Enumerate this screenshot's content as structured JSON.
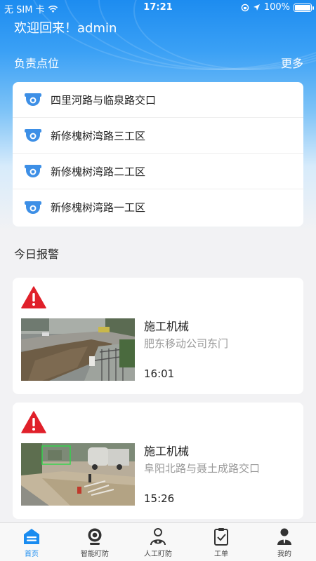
{
  "status_bar": {
    "carrier": "无 SIM 卡",
    "time": "17:21",
    "battery": "100%"
  },
  "header": {
    "welcome": "欢迎回来！admin",
    "section_title": "负责点位",
    "more_label": "更多"
  },
  "locations": [
    {
      "name": "四里河路与临泉路交口"
    },
    {
      "name": "新修槐树湾路三工区"
    },
    {
      "name": "新修槐树湾路二工区"
    },
    {
      "name": "新修槐树湾路一工区"
    }
  ],
  "alarms_title": "今日报警",
  "alarms": [
    {
      "type": "施工机械",
      "place": "肥东移动公司东门",
      "time": "16:01"
    },
    {
      "type": "施工机械",
      "place": "阜阳北路与聂土成路交口",
      "time": "15:26"
    }
  ],
  "tabs": [
    {
      "label": "首页",
      "icon": "home-icon",
      "active": true
    },
    {
      "label": "智能盯防",
      "icon": "camera-icon",
      "active": false
    },
    {
      "label": "人工盯防",
      "icon": "person-eye-icon",
      "active": false
    },
    {
      "label": "工单",
      "icon": "clipboard-icon",
      "active": false
    },
    {
      "label": "我的",
      "icon": "user-icon",
      "active": false
    }
  ],
  "colors": {
    "accent": "#1a8cf0",
    "warning": "#e0202a"
  }
}
